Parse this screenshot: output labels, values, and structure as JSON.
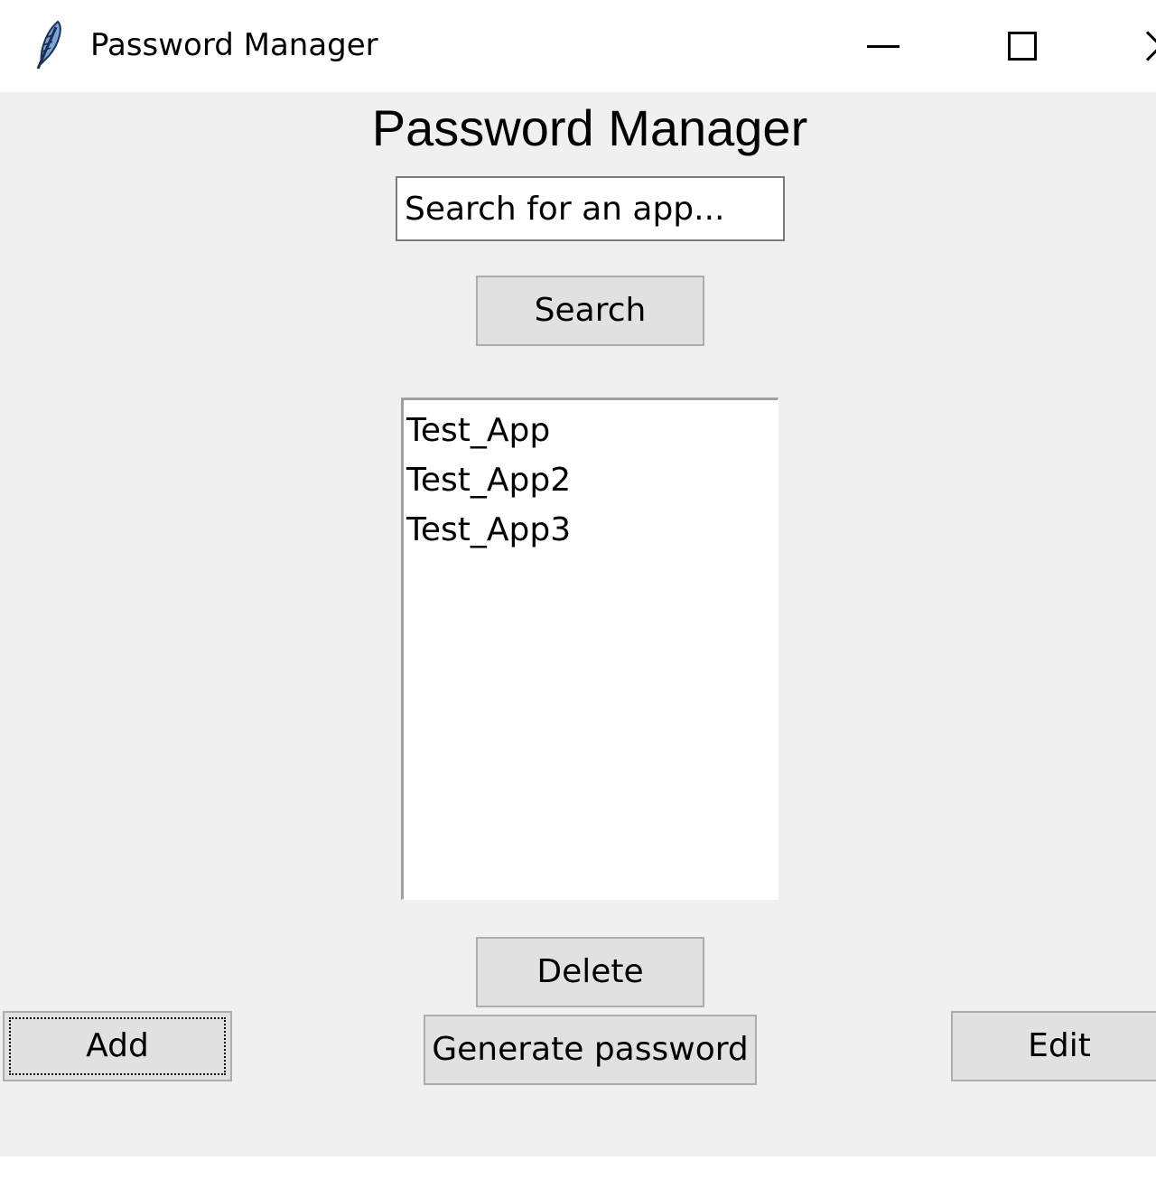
{
  "window": {
    "title": "Password Manager",
    "icon": "feather-icon",
    "controls": [
      "minimize-icon",
      "maximize-icon",
      "close-icon"
    ]
  },
  "main": {
    "heading": "Password Manager",
    "search": {
      "value": "Search for an app...",
      "placeholder": ""
    },
    "search_button": "Search",
    "apps": [
      "Test_App",
      "Test_App2",
      "Test_App3"
    ],
    "delete_button": "Delete",
    "add_button": "Add",
    "generate_button": "Generate password",
    "edit_button": "Edit"
  },
  "colors": {
    "background": "#f0f0f0",
    "button": "#e1e1e1",
    "button_border": "#adadad",
    "listbox": "#ffffff"
  }
}
